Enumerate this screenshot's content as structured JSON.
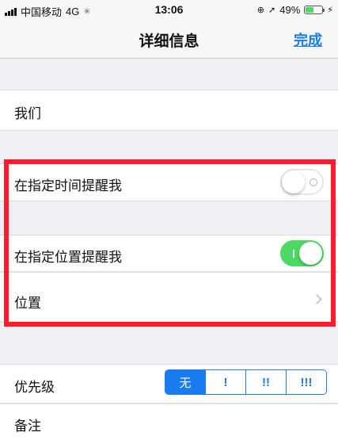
{
  "status_bar": {
    "carrier": "中国移动",
    "network": "4G",
    "time": "13:06",
    "battery_percent": "49%",
    "battery_level": 0.49
  },
  "nav": {
    "title": "详细信息",
    "done_label": "完成"
  },
  "reminder": {
    "title": "我们",
    "time_reminder_label": "在指定时间提醒我",
    "time_reminder_on": false,
    "location_reminder_label": "在指定位置提醒我",
    "location_reminder_on": true,
    "location_label": "位置"
  },
  "priority": {
    "label": "优先级",
    "options": [
      "无",
      "!",
      "!!",
      "!!!"
    ],
    "selected": "无"
  },
  "notes": {
    "label": "备注"
  },
  "colors": {
    "accent": "#1a7bf0",
    "toggle_on": "#4cd964",
    "highlight": "#ff1b2d"
  },
  "icons": {
    "signal": "signal-bars-icon",
    "loading": "loading-spinner-icon",
    "rotation_lock": "rotation-lock-icon",
    "location": "location-arrow-icon",
    "battery": "battery-icon",
    "charging": "charging-bolt-icon",
    "chevron": "chevron-right-icon"
  }
}
